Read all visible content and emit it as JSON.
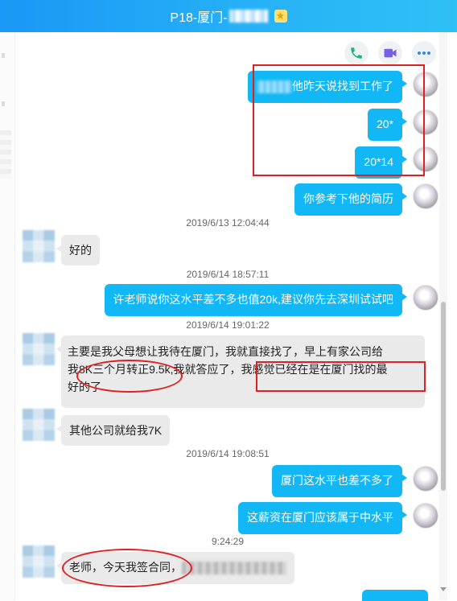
{
  "window": {
    "title_prefix": "P18-厦门-",
    "title_star": "★"
  },
  "actions": {
    "phone_icon": "phone-icon",
    "video_icon": "video-icon",
    "more_icon": "more-icon"
  },
  "messages": [
    {
      "dir": "out",
      "text": "他昨天说找到工作了",
      "blurred_prefix": true
    },
    {
      "dir": "out",
      "text": "20*"
    },
    {
      "dir": "out",
      "text": "20*14"
    },
    {
      "dir": "out",
      "text": "你参考下他的简历"
    },
    {
      "time": "2019/6/13 12:04:44"
    },
    {
      "dir": "in",
      "text": "好的"
    },
    {
      "time": "2019/6/14 18:57:11"
    },
    {
      "dir": "out",
      "text": "许老师说你这水平差不多也值20k,建议你先去深圳试试吧"
    },
    {
      "time": "2019/6/14 19:01:22"
    },
    {
      "dir": "in",
      "line1": "主要是我父母想让我待在厦门，我就直接找了，早上有家公司给",
      "line2": "我8K三个月转正9.5k,我就答应了，我感觉已经在是在厦门找的最",
      "line3": "好的了"
    },
    {
      "dir": "in",
      "text": "其他公司就给我7K"
    },
    {
      "time": "2019/6/14 19:08:51"
    },
    {
      "dir": "out",
      "text": "厦门这水平也差不多了"
    },
    {
      "dir": "out",
      "text": "这薪资在厦门应该属于中水平"
    },
    {
      "time": "9:24:29"
    },
    {
      "dir": "in",
      "text": "老师，今天我签合同，",
      "blurred_suffix": true
    }
  ],
  "colors": {
    "title_bar": "#1a98f5",
    "outgoing_bubble": "#12b7f5",
    "incoming_bubble": "#eaeaea",
    "annotation": "#e02020"
  }
}
